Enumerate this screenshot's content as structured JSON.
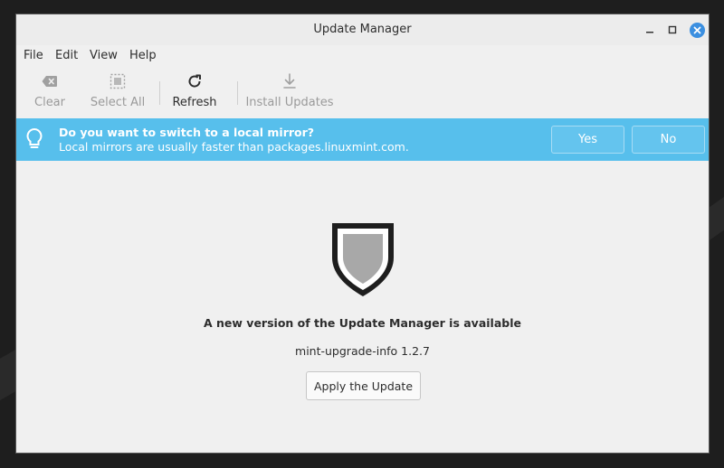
{
  "window": {
    "title": "Update Manager"
  },
  "menu": [
    "File",
    "Edit",
    "View",
    "Help"
  ],
  "toolbar": {
    "clear": "Clear",
    "select_all": "Select All",
    "refresh": "Refresh",
    "install_updates": "Install Updates"
  },
  "infobar": {
    "title": "Do you want to switch to a local mirror?",
    "subtitle": "Local mirrors are usually faster than packages.linuxmint.com.",
    "yes": "Yes",
    "no": "No",
    "color": "#57bfec"
  },
  "main": {
    "message": "A new version of the Update Manager is available",
    "version": "mint-upgrade-info 1.2.7",
    "apply_button": "Apply the Update"
  },
  "colors": {
    "accent": "#3b8fe0",
    "infobar": "#57bfec",
    "window_bg": "#f0f0f0"
  }
}
